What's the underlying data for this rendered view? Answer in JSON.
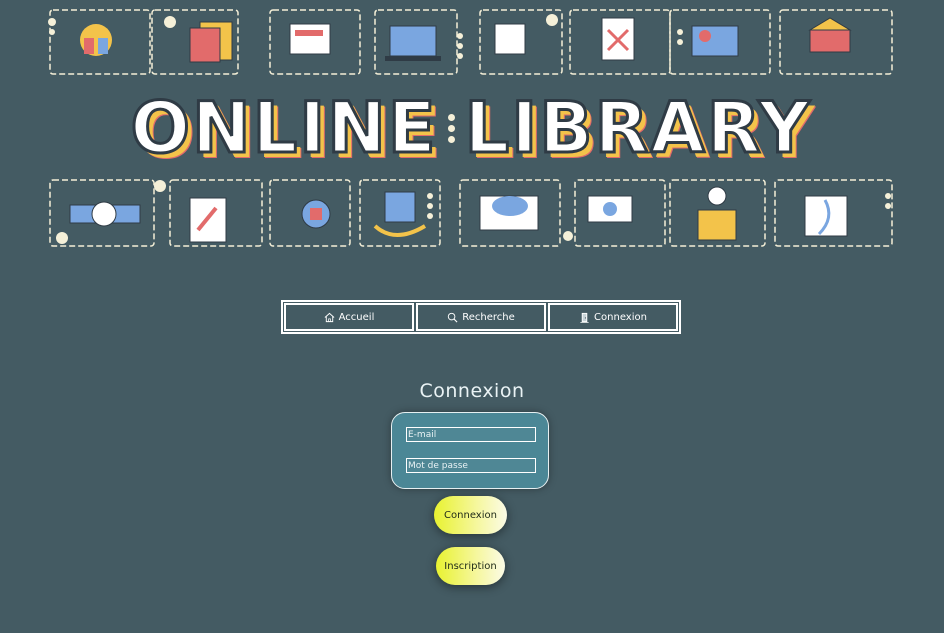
{
  "banner": {
    "word1": "ONLINE",
    "word2": "LIBRARY"
  },
  "nav": {
    "items": [
      {
        "label": "Accueil",
        "icon": "home-icon"
      },
      {
        "label": "Recherche",
        "icon": "search-icon"
      },
      {
        "label": "Connexion",
        "icon": "door-icon"
      }
    ]
  },
  "form": {
    "title": "Connexion",
    "email_placeholder": "E-mail",
    "password_placeholder": "Mot de passe",
    "login_label": "Connexion",
    "register_label": "Inscription"
  },
  "colors": {
    "background": "#445b63",
    "card": "#4b8796",
    "button_start": "#e8f230",
    "banner_accent_yellow": "#f3c34a",
    "banner_accent_pink": "#e26b6b"
  }
}
